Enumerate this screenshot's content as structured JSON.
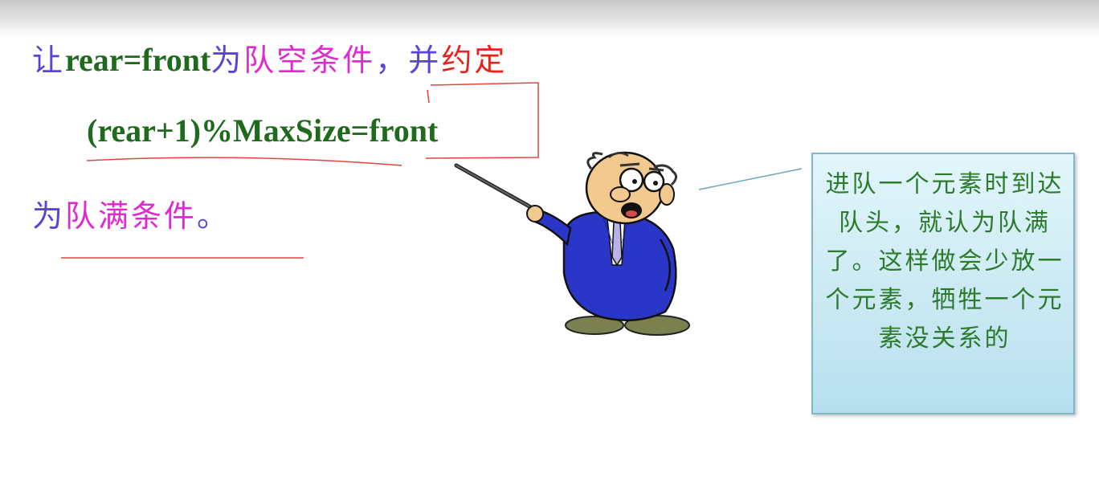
{
  "slide": {
    "line1": {
      "part1": "让",
      "part2": "rear=front",
      "part3": "为",
      "part4": "队空条件",
      "part5": "，并",
      "part6": "约定"
    },
    "formula": "(rear+1)%MaxSize=front",
    "line3": {
      "part1": "为",
      "part2": "队满条件",
      "part3": "。"
    }
  },
  "callout": {
    "text": "进队一个元素时到达队头，就认为队满了。这样做会少放一个元素，牺牲一个元素没关系的"
  },
  "colors": {
    "blue": "#5c43d8",
    "pink": "#e02ad0",
    "red": "#e8211c",
    "green": "#1f6a1c",
    "callout_text": "#2c7a2c",
    "annotation": "#e0443c"
  }
}
